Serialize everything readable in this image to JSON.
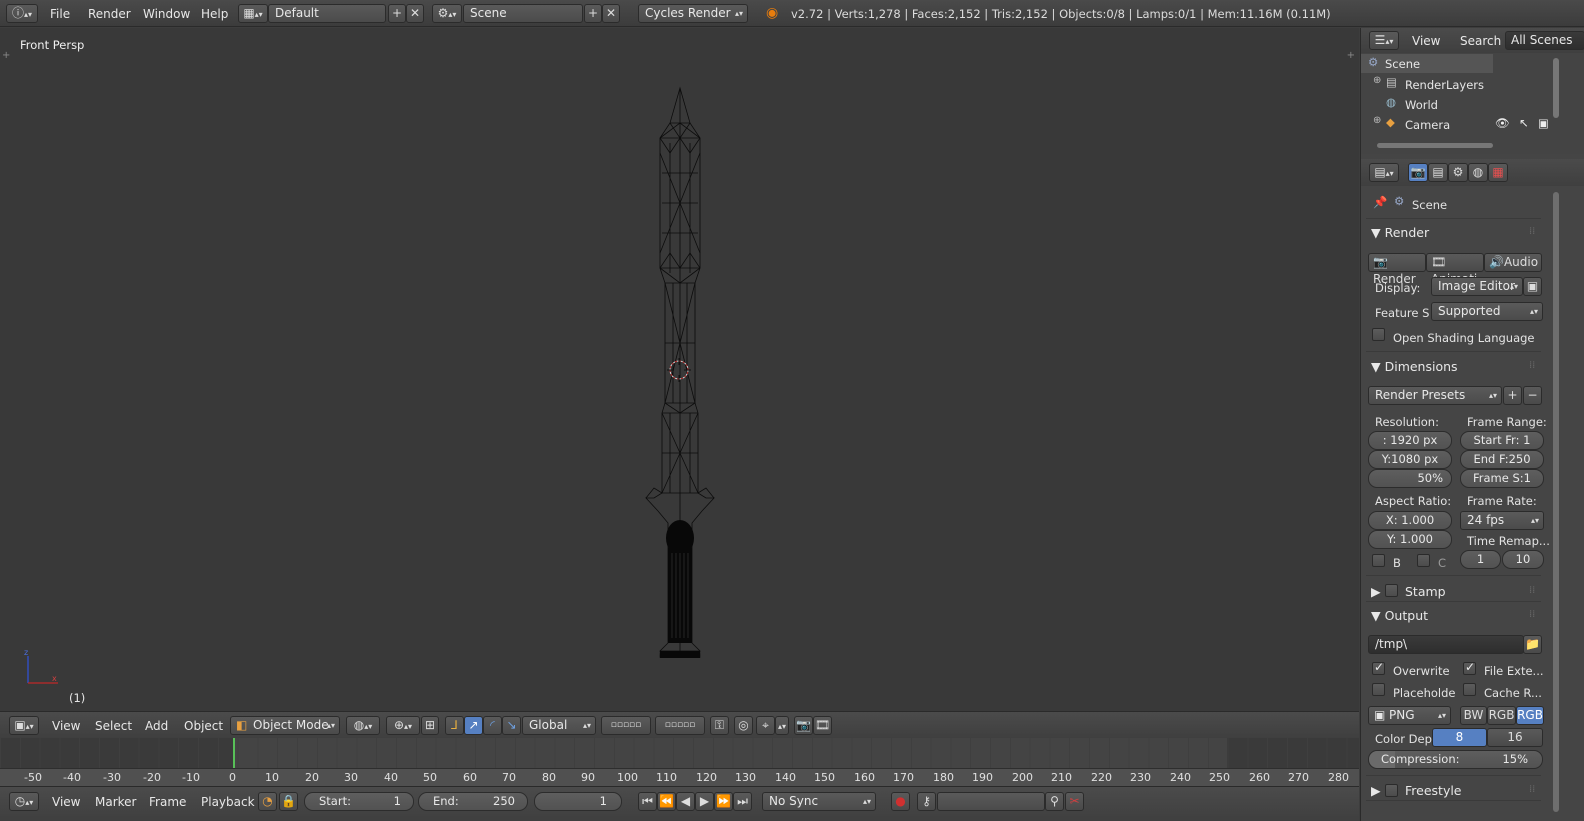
{
  "topbar": {
    "menus": [
      "File",
      "Render",
      "Window",
      "Help"
    ],
    "screen_layout": "Default",
    "scene": "Scene",
    "render_engine": "Cycles Render",
    "stats": "v2.72 | Verts:1,278 | Faces:2,152 | Tris:2,152 | Objects:0/8 | Lamps:0/1 | Mem:11.16M (0.11M)"
  },
  "viewport": {
    "view_label": "Front Persp",
    "frame_label": "(1)"
  },
  "viewport_header": {
    "menus": [
      "View",
      "Select",
      "Add",
      "Object"
    ],
    "mode": "Object Mode",
    "orientation": "Global"
  },
  "timeline": {
    "ruler": [
      "-50",
      "-40",
      "-30",
      "-20",
      "-10",
      "0",
      "10",
      "20",
      "30",
      "40",
      "50",
      "60",
      "70",
      "80",
      "90",
      "100",
      "110",
      "120",
      "130",
      "140",
      "150",
      "160",
      "170",
      "180",
      "190",
      "200",
      "210",
      "220",
      "230",
      "240",
      "250",
      "260",
      "270",
      "280"
    ],
    "menus": [
      "View",
      "Marker",
      "Frame",
      "Playback"
    ],
    "start_label": "Start:",
    "start_value": "1",
    "end_label": "End:",
    "end_value": "250",
    "current_frame": "1",
    "sync": "No Sync"
  },
  "outliner": {
    "header": [
      "View",
      "Search",
      "All Scenes"
    ],
    "items": [
      "Scene",
      "RenderLayers",
      "World",
      "Camera"
    ]
  },
  "properties": {
    "context": "Scene",
    "render_panel": {
      "title": "Render",
      "buttons": [
        "Render",
        "Animati",
        "Audio"
      ],
      "display_label": "Display:",
      "display_value": "Image Editor",
      "feature_label": "Feature S",
      "feature_value": "Supported",
      "osl_label": "Open Shading Language"
    },
    "dimensions_panel": {
      "title": "Dimensions",
      "presets": "Render Presets",
      "resolution_label": "Resolution:",
      "res_x": "1920 px",
      "res_x_prefix": ":",
      "res_y": "Y:1080 px",
      "res_pct": "50%",
      "frame_range_label": "Frame Range:",
      "start_fr": "Start Fr:",
      "start_fr_val": "1",
      "end_f": "End F:",
      "end_f_val": "250",
      "frame_s": "Frame S:",
      "frame_s_val": "1",
      "aspect_label": "Aspect Ratio:",
      "aspect_x_label": "X:",
      "aspect_x": "1.000",
      "aspect_y_label": "Y:",
      "aspect_y": "1.000",
      "frame_rate_label": "Frame Rate:",
      "frame_rate": "24 fps",
      "time_remap_label": "Time Remap...",
      "remap_old": "1",
      "remap_new": "10",
      "b_label": "B",
      "c_label": "C"
    },
    "stamp_panel": {
      "title": "Stamp"
    },
    "output_panel": {
      "title": "Output",
      "path": "/tmp\\",
      "overwrite": "Overwrite",
      "file_ext": "File Exte...",
      "placeholder": "Placeholde",
      "cache": "Cache R...",
      "format": "PNG",
      "bw": "BW",
      "rgb": "RGB",
      "rgba": "RGB",
      "color_depth_label": "Color Dep",
      "depth_8": "8",
      "depth_16": "16",
      "compression_label": "Compression:",
      "compression_value": "15%"
    },
    "freestyle_panel": {
      "title": "Freestyle"
    }
  }
}
